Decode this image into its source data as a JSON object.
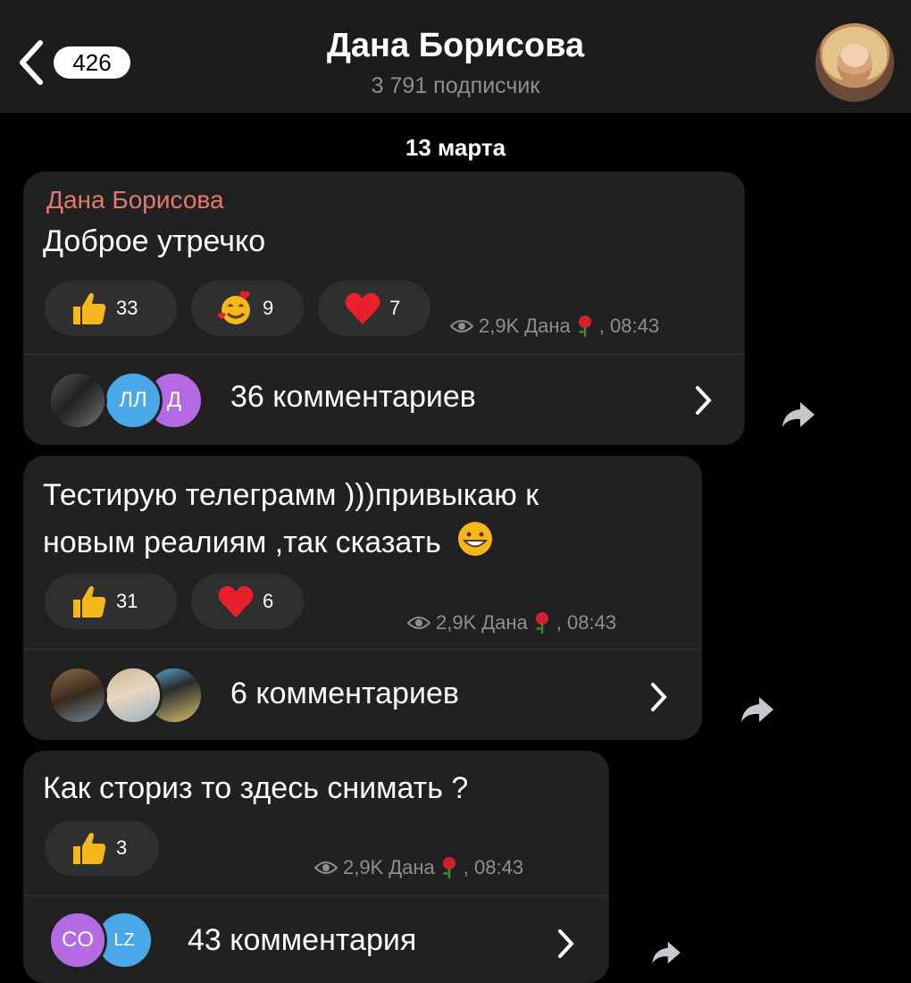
{
  "header": {
    "back_count": "426",
    "title": "Дана Борисова",
    "subtitle": "3 791 подписчик"
  },
  "date_separator": "13 марта",
  "colors": {
    "bubble": "#212121",
    "author": "#e27a6c",
    "reaction_bg": "#2f2f31",
    "meta": "#8e8e93",
    "heart": "#e8202b",
    "thumb": "#f5b81c"
  },
  "posts": [
    {
      "author": "Дана Борисова",
      "text_lines": [
        "Доброе утречко"
      ],
      "reactions": [
        {
          "icon": "thumbs-up-icon",
          "count": "33"
        },
        {
          "icon": "smiling-face-with-hearts-icon",
          "count": "9"
        },
        {
          "icon": "heart-icon",
          "count": "7"
        }
      ],
      "views": "2,9K",
      "signature": "Дана",
      "time": ", 08:43",
      "commenter_avatars": [
        "",
        "ЛЛ",
        "Д"
      ],
      "comments": "36 комментариев"
    },
    {
      "text_lines": [
        "Тестирую телеграмм )))привыкаю к",
        "новым реалиям ,так сказать"
      ],
      "reactions": [
        {
          "icon": "thumbs-up-icon",
          "count": "31"
        },
        {
          "icon": "heart-icon",
          "count": "6"
        }
      ],
      "views": "2,9K",
      "signature": "Дана",
      "time": ", 08:43",
      "comments": "6 комментариев"
    },
    {
      "text_lines": [
        "Как сториз то здесь снимать ?"
      ],
      "reactions": [
        {
          "icon": "thumbs-up-icon",
          "count": "3"
        }
      ],
      "views": "2,9K",
      "signature": "Дана",
      "time": ", 08:43",
      "commenter_avatars": [
        "CO",
        "LZ"
      ],
      "comments": "43 комментария"
    }
  ]
}
